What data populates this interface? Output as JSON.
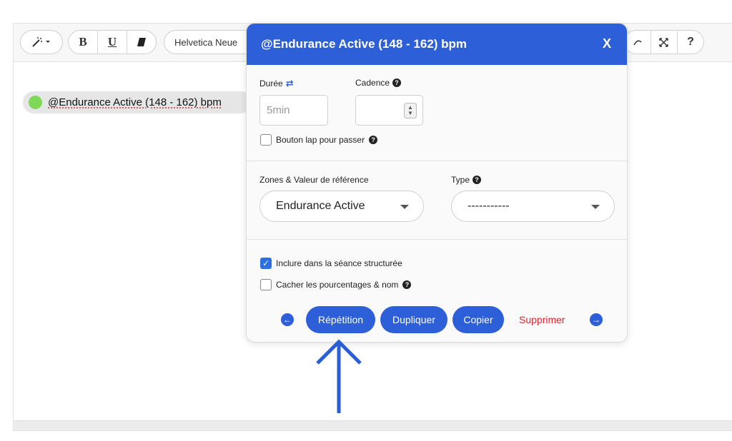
{
  "toolbar": {
    "font_name": "Helvetica Neue",
    "bold_label": "B",
    "underline_label": "U",
    "help_label": "?",
    "icons": [
      "magic-wand-icon",
      "eraser-icon",
      "fullscreen-icon"
    ]
  },
  "editor": {
    "chip_text": "@Endurance Active (148 - 162) bpm",
    "chip_color": "#7ed957"
  },
  "panel": {
    "title": "@Endurance Active (148 - 162) bpm",
    "close_label": "X",
    "header_color": "#2d5fd8",
    "duration": {
      "label": "Durée",
      "placeholder": "5min"
    },
    "cadence": {
      "label": "Cadence",
      "value": ""
    },
    "lap_button": {
      "label": "Bouton lap pour passer",
      "checked": false
    },
    "zones": {
      "label": "Zones & Valeur de référence",
      "selected": "Endurance Active"
    },
    "type": {
      "label": "Type",
      "selected": "-----------"
    },
    "include": {
      "label": "Inclure dans la séance structurée",
      "checked": true
    },
    "hide": {
      "label": "Cacher les pourcentages & nom",
      "checked": false
    },
    "actions": {
      "repeat": "Répétition",
      "duplicate": "Dupliquer",
      "copy": "Copier",
      "delete": "Supprimer"
    },
    "accent_color": "#2d5fd8",
    "danger_color": "#e0262b"
  }
}
